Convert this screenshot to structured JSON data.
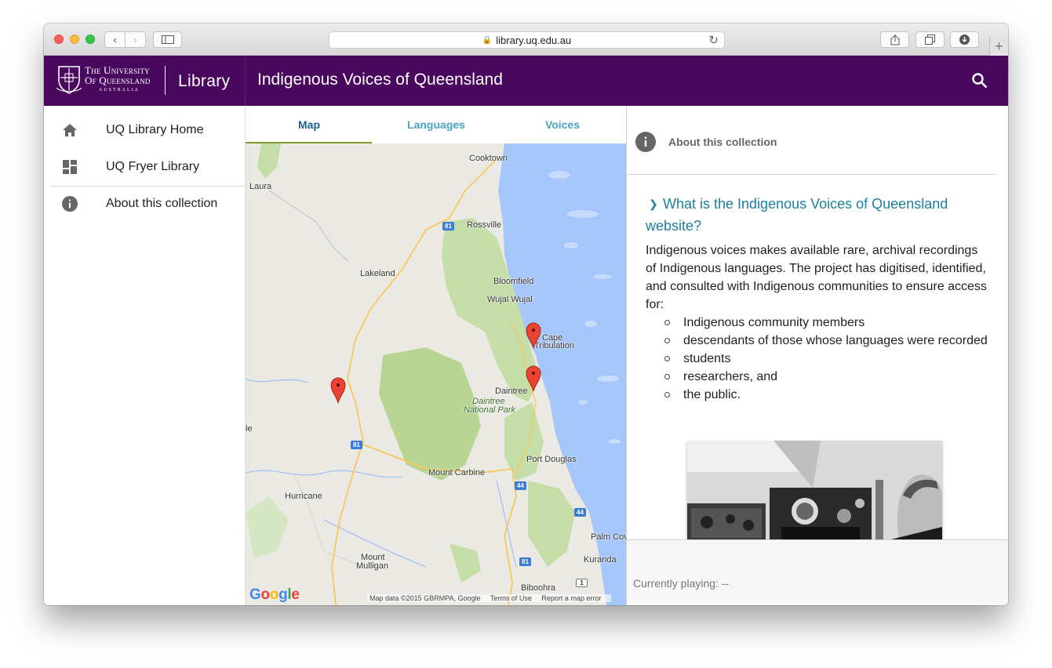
{
  "browser": {
    "url": "library.uq.edu.au"
  },
  "header": {
    "uni_line1": "The University",
    "uni_line2": "Of Queensland",
    "uni_sub": "AUSTRALIA",
    "library": "Library",
    "title": "Indigenous Voices of Queensland",
    "brand_color": "#49075e"
  },
  "sidebar": {
    "items": [
      {
        "label": "UQ Library Home",
        "icon": "home-icon"
      },
      {
        "label": "UQ Fryer Library",
        "icon": "dashboard-icon"
      },
      {
        "label": "About this collection",
        "icon": "info-icon"
      }
    ]
  },
  "tabs": [
    {
      "label": "Map",
      "active": true
    },
    {
      "label": "Languages",
      "active": false
    },
    {
      "label": "Voices",
      "active": false
    }
  ],
  "map": {
    "places": [
      "Cooktown",
      "Laura",
      "Rossville",
      "Lakeland",
      "Bloomfield",
      "Wujal Wujal",
      "Cape",
      "Tribulation",
      "Daintree",
      "Daintree",
      "National Park",
      "Port Douglas",
      "Mount Carbine",
      "Hurricane",
      "Mount",
      "Mulligan",
      "Palm Cov",
      "Kuranda",
      "Biboohra",
      "le"
    ],
    "road_shields": [
      "81",
      "81",
      "44",
      "44",
      "81",
      "1"
    ],
    "google": "Google",
    "footer": [
      "Map data ©2015 GBRMPA, Google",
      "Terms of Use",
      "Report a map error"
    ]
  },
  "panel": {
    "header_title": "About this collection",
    "question": "What is the Indigenous Voices of Queensland website?",
    "answer": "Indigenous voices makes available rare, archival recordings of Indigenous languages. The project has digitised, identified, and consulted with Indigenous communities to ensure access for:",
    "list": [
      "Indigenous community members",
      "descendants of those whose languages were recorded",
      "students",
      "researchers, and",
      "the public."
    ]
  },
  "player": {
    "status": "Currently playing: --"
  }
}
